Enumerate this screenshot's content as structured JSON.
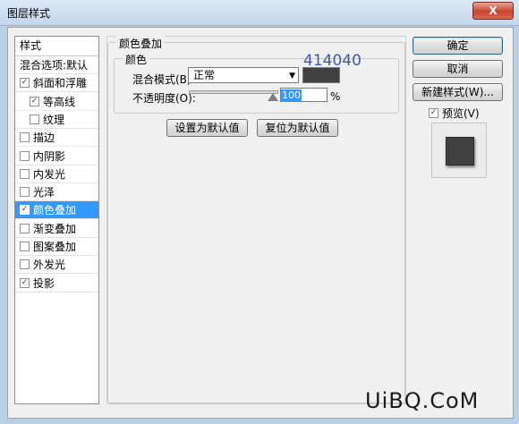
{
  "window": {
    "title": "图层样式",
    "close_glyph": "X"
  },
  "stylelist": {
    "header": "样式",
    "items": [
      {
        "label": "混合选项:默认",
        "checkbox": false,
        "indent": false,
        "checked": false,
        "selected": false
      },
      {
        "label": "斜面和浮雕",
        "checkbox": true,
        "indent": false,
        "checked": true,
        "selected": false
      },
      {
        "label": "等高线",
        "checkbox": true,
        "indent": true,
        "checked": true,
        "selected": false
      },
      {
        "label": "纹理",
        "checkbox": true,
        "indent": true,
        "checked": false,
        "selected": false
      },
      {
        "label": "描边",
        "checkbox": true,
        "indent": false,
        "checked": false,
        "selected": false
      },
      {
        "label": "内阴影",
        "checkbox": true,
        "indent": false,
        "checked": false,
        "selected": false
      },
      {
        "label": "内发光",
        "checkbox": true,
        "indent": false,
        "checked": false,
        "selected": false
      },
      {
        "label": "光泽",
        "checkbox": true,
        "indent": false,
        "checked": false,
        "selected": false
      },
      {
        "label": "颜色叠加",
        "checkbox": true,
        "indent": false,
        "checked": true,
        "selected": true
      },
      {
        "label": "渐变叠加",
        "checkbox": true,
        "indent": false,
        "checked": false,
        "selected": false
      },
      {
        "label": "图案叠加",
        "checkbox": true,
        "indent": false,
        "checked": false,
        "selected": false
      },
      {
        "label": "外发光",
        "checkbox": true,
        "indent": false,
        "checked": false,
        "selected": false
      },
      {
        "label": "投影",
        "checkbox": true,
        "indent": false,
        "checked": true,
        "selected": false
      }
    ]
  },
  "color_overlay": {
    "group_title": "颜色叠加",
    "subgroup_title": "颜色",
    "blend_mode_label": "混合模式(B):",
    "blend_mode_value": "正常",
    "overlay_color": "#414040",
    "opacity_label": "不透明度(O):",
    "opacity_value": "100",
    "opacity_unit": "%",
    "opacity_level": 1.0,
    "set_default_label": "设置为默认值",
    "reset_default_label": "复位为默认值"
  },
  "annotation": {
    "hex_text": "414040"
  },
  "buttons": {
    "ok": "确定",
    "cancel": "取消",
    "new_style": "新建样式(W)...",
    "preview_label": "预览(V)",
    "preview_checked": true
  },
  "watermark": "UiBQ.CoM",
  "colors": {
    "selection": "#3399ff",
    "overlay": "#414040",
    "annotation": "#3b5aa8"
  }
}
